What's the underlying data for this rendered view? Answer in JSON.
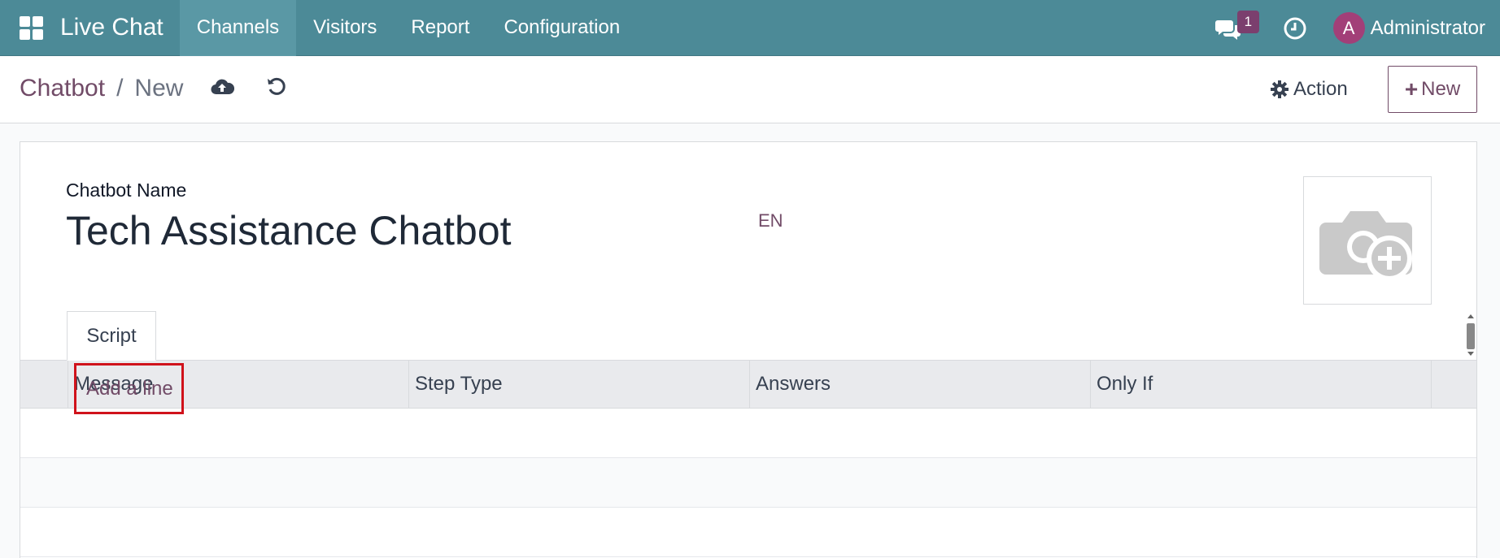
{
  "navbar": {
    "app_name": "Live Chat",
    "menu": [
      "Channels",
      "Visitors",
      "Report",
      "Configuration"
    ],
    "active_menu": "Channels",
    "chat_badge": "1",
    "user_initial": "A",
    "user_name": "Administrator"
  },
  "control": {
    "breadcrumb_parent": "Chatbot",
    "breadcrumb_sep": "/",
    "breadcrumb_current": "New",
    "action_label": "Action",
    "new_label": "New"
  },
  "form": {
    "name_label": "Chatbot Name",
    "name_value": "Tech Assistance Chatbot",
    "lang": "EN",
    "tab_label": "Script",
    "columns": [
      "Message",
      "Step Type",
      "Answers",
      "Only If"
    ],
    "add_line_label": "Add a line"
  },
  "colors": {
    "navbar": "#4c8a97",
    "accent": "#714b67",
    "badge": "#7b3f6e",
    "avatar": "#a23f78",
    "highlight_box": "#d0121b"
  }
}
